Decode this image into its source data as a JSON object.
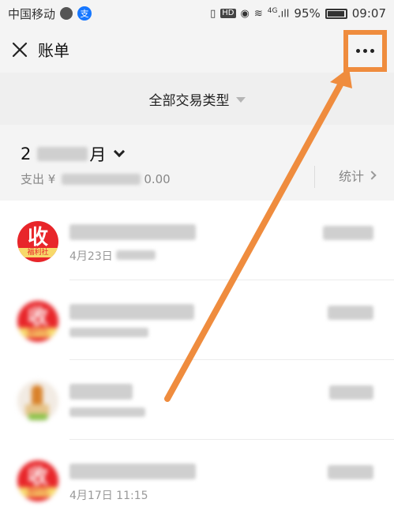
{
  "status_bar": {
    "carrier": "中国移动",
    "signal_label": "4G",
    "battery": "95%",
    "time": "09:07"
  },
  "nav": {
    "title": "账单"
  },
  "filter": {
    "label": "全部交易类型"
  },
  "month": {
    "label_prefix": "2",
    "label_suffix": "月",
    "summary_prefix": "支出 ¥",
    "summary_suffix": "0.00",
    "stats_label": "统计"
  },
  "transactions": [
    {
      "avatar_text": "收",
      "avatar_sub": "福利社",
      "subtitle": "4月23日"
    },
    {
      "avatar_text": "收",
      "avatar_sub": "福利社",
      "subtitle": ""
    },
    {
      "avatar_text": "",
      "avatar_sub": "",
      "subtitle": ""
    },
    {
      "avatar_text": "收",
      "avatar_sub": "福利社",
      "subtitle": "4月17日 11:15"
    }
  ],
  "colors": {
    "annotation": "#ef8c3e",
    "avatar_red": "#e8262a"
  }
}
